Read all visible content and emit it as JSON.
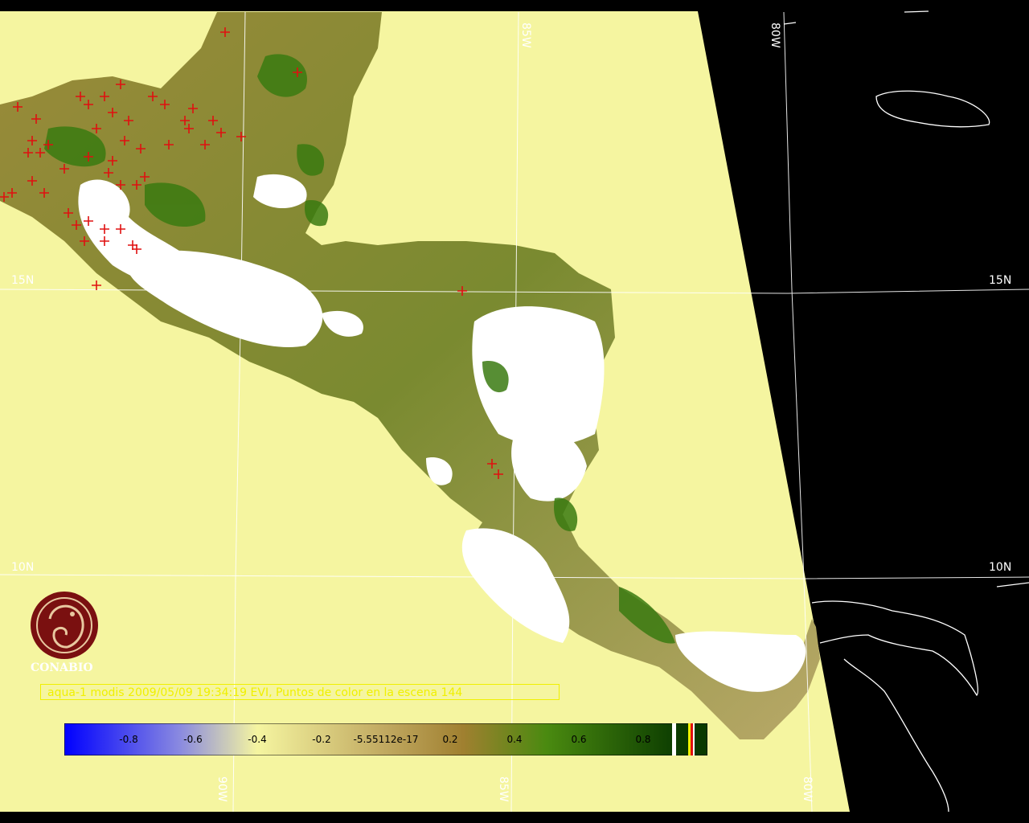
{
  "grid_labels": {
    "lat_15": "15N",
    "lat_10": "10N",
    "lon_85": "85W",
    "lon_80": "80W",
    "lon_90": "90W"
  },
  "title": "aqua-1 modis 2009/05/09 19:34:19 EVI, Puntos de color en la escena 144",
  "logo": {
    "name": "CONABIO",
    "icon": "conabio-macaw-logo-icon",
    "color": "#7a1010"
  },
  "colorbar": {
    "ticks": [
      "-0.8",
      "-0.6",
      "-0.4",
      "-0.2",
      "-5.55112e-17",
      "0.2",
      "0.4",
      "0.6",
      "0.8"
    ],
    "colors": {
      "low": "#0000ff",
      "mid": "#f5f5a0",
      "tan": "#a08030",
      "high": "#1a5a00"
    }
  },
  "colors": {
    "water": "#f5f5a0",
    "no_data": "#000000",
    "cloud": "#ffffff",
    "vegetation": "#6b8a2a",
    "fire_point": "#e01010",
    "grid": "#ffffff"
  }
}
